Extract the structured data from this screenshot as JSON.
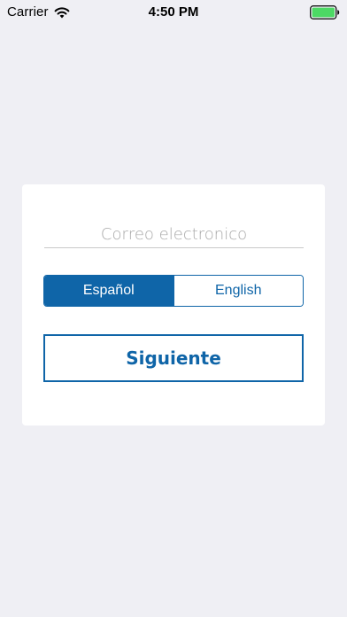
{
  "status_bar": {
    "carrier": "Carrier",
    "time": "4:50 PM",
    "wifi_icon": "wifi-icon",
    "battery_icon": "battery-full-icon",
    "battery_color": "#4cd964"
  },
  "login_card": {
    "email_placeholder": "Correo electronico",
    "email_value": "",
    "language_options": [
      "Español",
      "English"
    ],
    "selected_language": "Español",
    "next_label": "Siguiente"
  },
  "colors": {
    "accent": "#0f65a8",
    "background": "#efeff4",
    "card": "#ffffff"
  }
}
